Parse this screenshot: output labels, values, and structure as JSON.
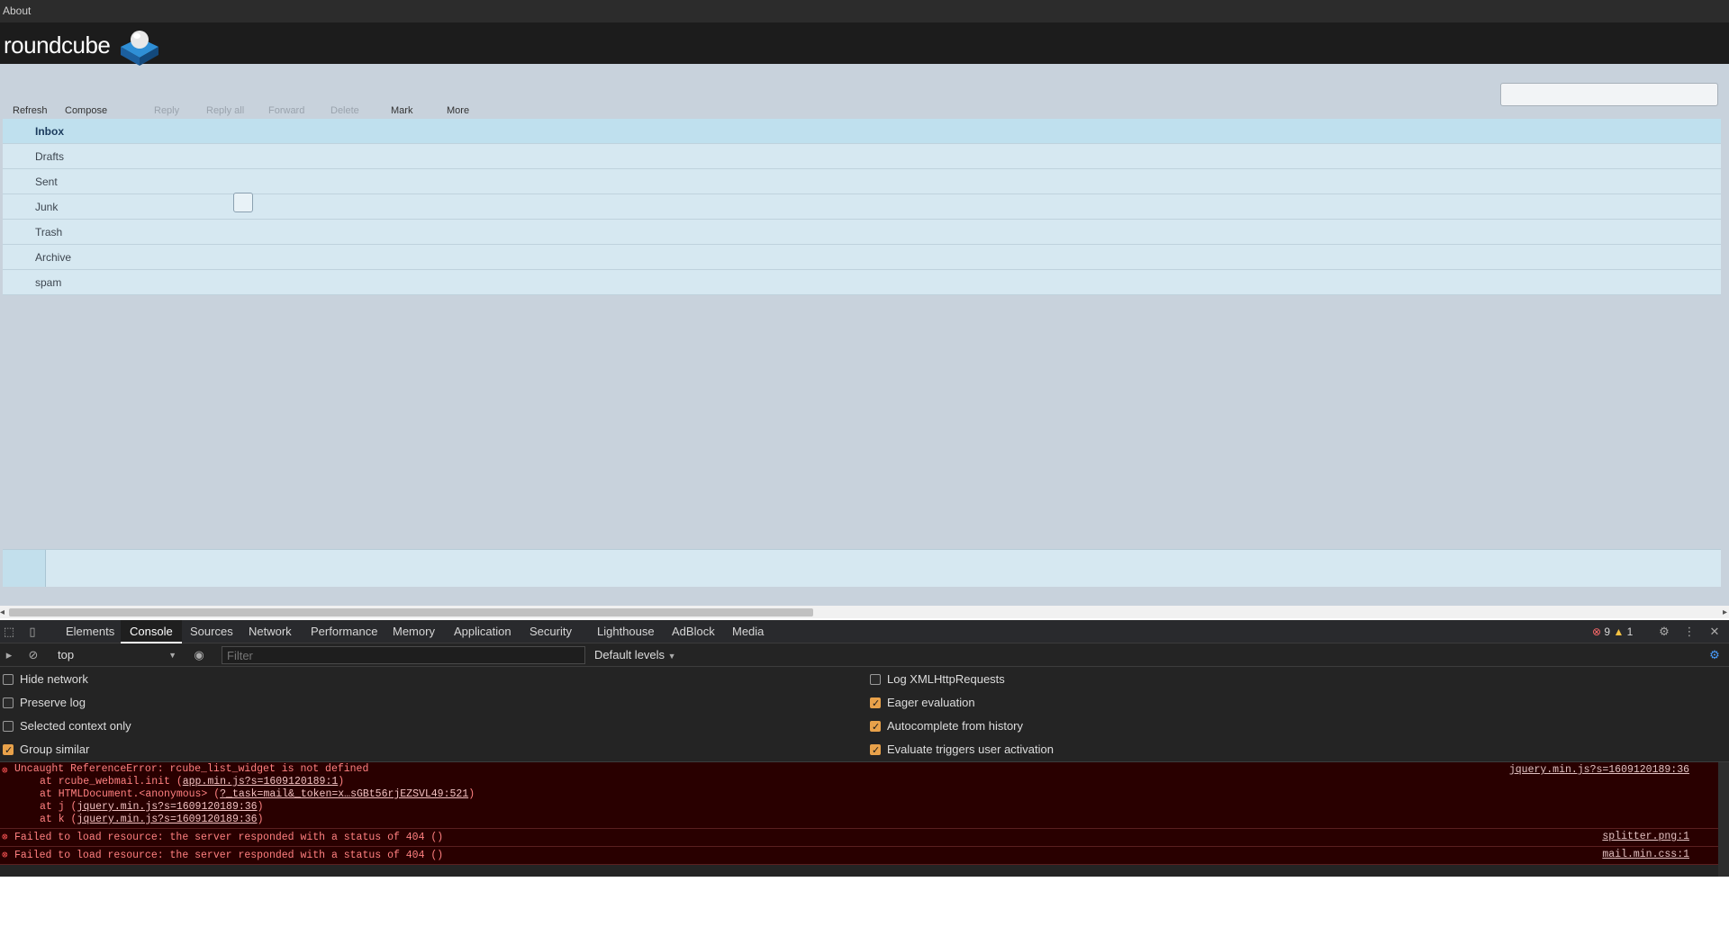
{
  "topbar": {
    "about_label": "About"
  },
  "header": {
    "logo_text": "roundcube"
  },
  "search": {
    "placeholder": ""
  },
  "toolbar": {
    "refresh": "Refresh",
    "compose": "Compose",
    "reply": "Reply",
    "reply_all": "Reply all",
    "forward": "Forward",
    "delete": "Delete",
    "mark": "Mark",
    "more": "More"
  },
  "folders": [
    {
      "label": "Inbox",
      "selected": true
    },
    {
      "label": "Drafts",
      "selected": false
    },
    {
      "label": "Sent",
      "selected": false
    },
    {
      "label": "Junk",
      "selected": false
    },
    {
      "label": "Trash",
      "selected": false
    },
    {
      "label": "Archive",
      "selected": false
    },
    {
      "label": "spam",
      "selected": false
    }
  ],
  "devtools": {
    "tabs": [
      "Elements",
      "Console",
      "Sources",
      "Network",
      "Performance",
      "Memory",
      "Application",
      "Security",
      "Lighthouse",
      "AdBlock",
      "Media"
    ],
    "active_tab": "Console",
    "error_count": "9",
    "warning_count": "1",
    "context": "top",
    "filter_placeholder": "Filter",
    "levels_label": "Default levels",
    "options_left": [
      {
        "label": "Hide network",
        "checked": false
      },
      {
        "label": "Preserve log",
        "checked": false
      },
      {
        "label": "Selected context only",
        "checked": false
      },
      {
        "label": "Group similar",
        "checked": true
      }
    ],
    "options_right": [
      {
        "label": "Log XMLHttpRequests",
        "checked": false
      },
      {
        "label": "Eager evaluation",
        "checked": true
      },
      {
        "label": "Autocomplete from history",
        "checked": true
      },
      {
        "label": "Evaluate triggers user activation",
        "checked": true
      }
    ],
    "logs": [
      {
        "message": "Uncaught ReferenceError: rcube_list_widget is not defined",
        "trace": [
          {
            "prefix": "at rcube_webmail.init (",
            "link": "app.min.js?s=1609120189:1",
            "suffix": ")"
          },
          {
            "prefix": "at HTMLDocument.<anonymous> (",
            "link": "?_task=mail&_token=x…sGBt56rjEZSVL49:521",
            "suffix": ")"
          },
          {
            "prefix": "at j (",
            "link": "jquery.min.js?s=1609120189:36",
            "suffix": ")"
          },
          {
            "prefix": "at k (",
            "link": "jquery.min.js?s=1609120189:36",
            "suffix": ")"
          }
        ],
        "source": "jquery.min.js?s=1609120189:36"
      },
      {
        "message": "Failed to load resource: the server responded with a status of 404 ()",
        "trace": [],
        "source": "splitter.png:1"
      },
      {
        "message": "Failed to load resource: the server responded with a status of 404 ()",
        "trace": [],
        "source": "mail.min.css:1"
      }
    ]
  },
  "colors": {
    "app_bg": "#c8d2dc",
    "header_bg": "#1c1c1c",
    "folder_bg": "#d6e8f1",
    "selected_folder_bg": "#bfe0ee",
    "devtools_bg": "#242424",
    "error_bg": "#290000",
    "error_text": "#ff8080"
  }
}
